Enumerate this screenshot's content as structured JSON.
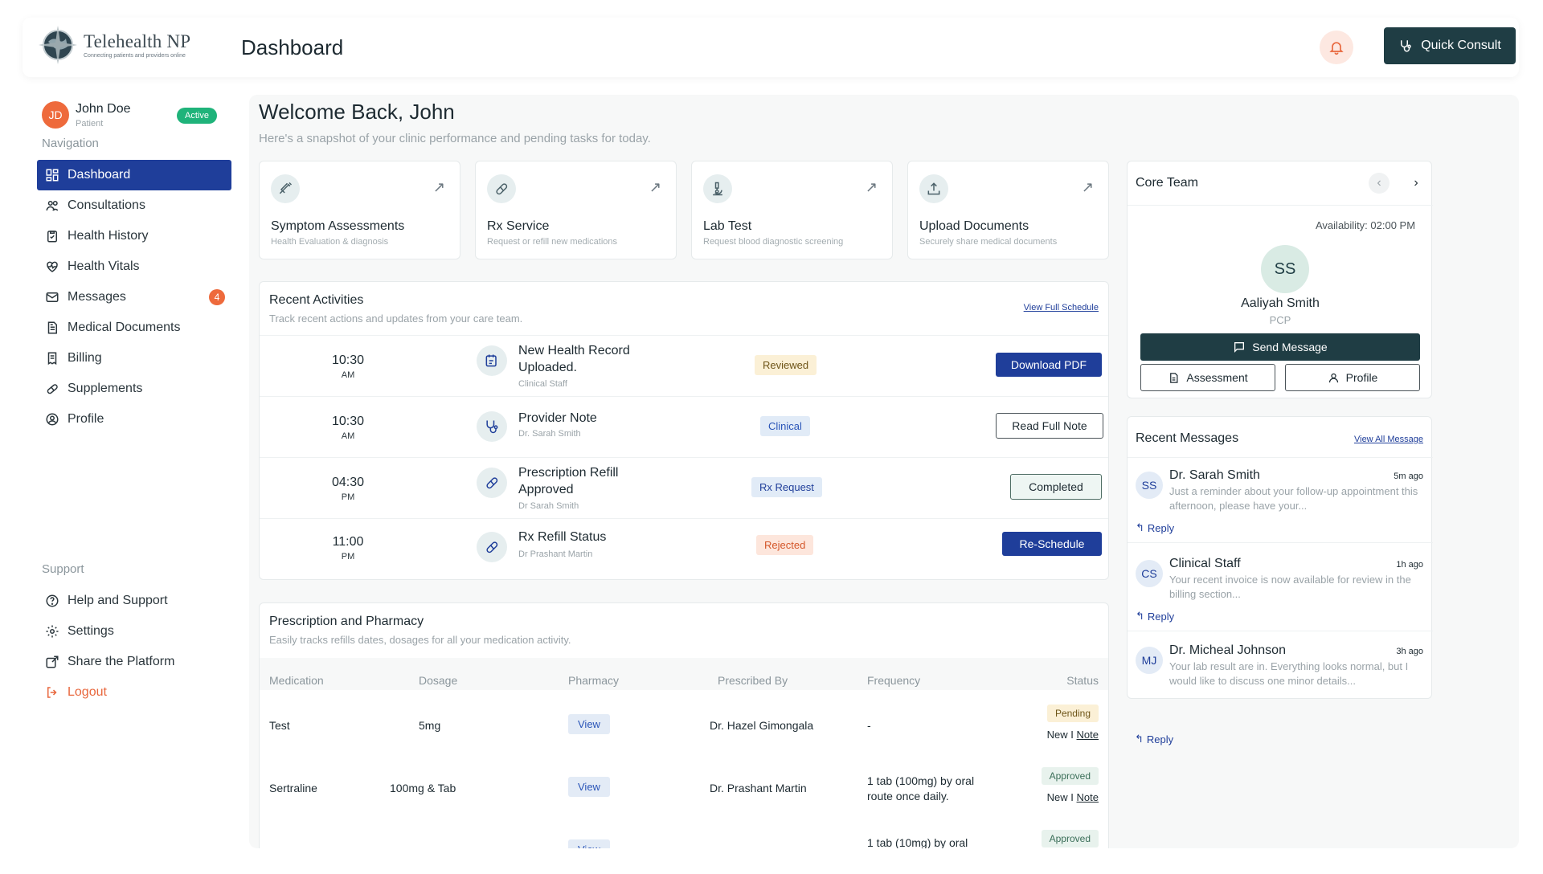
{
  "app": {
    "logo_name": "Telehealth NP",
    "logo_tagline": "Connecting patients and providers online",
    "page_title": "Dashboard",
    "quick_consult": "Quick Consult"
  },
  "user": {
    "initials": "JD",
    "name": "John Doe",
    "role": "Patient",
    "status": "Active"
  },
  "sidebar": {
    "nav_heading": "Navigation",
    "items": [
      {
        "label": "Dashboard",
        "icon": "grid-icon"
      },
      {
        "label": "Consultations",
        "icon": "users-icon"
      },
      {
        "label": "Health History",
        "icon": "clipboard-icon"
      },
      {
        "label": "Health Vitals",
        "icon": "heart-pulse-icon"
      },
      {
        "label": "Messages",
        "icon": "mail-icon",
        "count": "4"
      },
      {
        "label": "Medical Documents",
        "icon": "document-icon"
      },
      {
        "label": "Billing",
        "icon": "receipt-icon"
      },
      {
        "label": "Supplements",
        "icon": "pill-icon"
      },
      {
        "label": "Profile",
        "icon": "user-circle-icon"
      }
    ],
    "support_heading": "Support",
    "support_items": [
      {
        "label": "Help and Support",
        "icon": "help-icon"
      },
      {
        "label": "Settings",
        "icon": "gear-icon"
      },
      {
        "label": "Share the Platform",
        "icon": "share-icon"
      }
    ],
    "logout": "Logout"
  },
  "welcome": {
    "title": "Welcome Back, John",
    "subtitle": "Here's a snapshot of your clinic performance and pending tasks for today."
  },
  "services": [
    {
      "title": "Symptom Assessments",
      "subtitle": "Health Evaluation & diagnosis",
      "icon": "syringe-icon"
    },
    {
      "title": "Rx Service",
      "subtitle": "Request or refill new medications",
      "icon": "pill-icon"
    },
    {
      "title": "Lab Test",
      "subtitle": "Request blood diagnostic screening",
      "icon": "microscope-icon"
    },
    {
      "title": "Upload Documents",
      "subtitle": "Securely share medical documents",
      "icon": "upload-icon"
    }
  ],
  "activities": {
    "title": "Recent Activities",
    "subtitle": "Track recent actions and updates from your care team.",
    "link": "View Full Schedule",
    "rows": [
      {
        "time": "10:30",
        "ampm": "AM",
        "title": "New Health Record Uploaded.",
        "by": "Clinical Staff",
        "tag": "Reviewed",
        "action": "Download PDF"
      },
      {
        "time": "10:30",
        "ampm": "AM",
        "title": "Provider Note",
        "by": "Dr. Sarah Smith",
        "tag": "Clinical",
        "action": "Read Full Note"
      },
      {
        "time": "04:30",
        "ampm": "PM",
        "title": "Prescription Refill Approved",
        "by": "Dr Sarah Smith",
        "tag": "Rx Request",
        "action": "Completed"
      },
      {
        "time": "11:00",
        "ampm": "PM",
        "title": "Rx Refill Status",
        "by": "Dr Prashant Martin",
        "tag": "Rejected",
        "action": "Re-Schedule"
      }
    ]
  },
  "pharmacy": {
    "title": "Prescription and Pharmacy",
    "subtitle": "Easily tracks refills dates, dosages for all your medication activity.",
    "columns": [
      "Medication",
      "Dosage",
      "Pharmacy",
      "Prescribed By",
      "Frequency",
      "Status"
    ],
    "rows": [
      {
        "medication": "Test",
        "dosage": "5mg",
        "pharmacy": "View",
        "prescribed_by": "Dr. Hazel Gimongala",
        "frequency": "-",
        "status": "Pending",
        "new": "New",
        "note": "Note"
      },
      {
        "medication": "Sertraline",
        "dosage": "100mg & Tab",
        "pharmacy": "View",
        "prescribed_by": "Dr. Prashant Martin",
        "frequency": "1 tab (100mg) by oral route once daily.",
        "status": "Approved",
        "new": "New",
        "note": "Note"
      },
      {
        "medication": "",
        "dosage": "",
        "pharmacy": "View",
        "prescribed_by": "",
        "frequency": "1 tab (10mg) by oral",
        "status": "Approved"
      }
    ]
  },
  "core_team": {
    "title": "Core Team",
    "availability": "Availability: 02:00 PM",
    "initials": "SS",
    "name": "Aaliyah Smith",
    "role": "PCP",
    "send_message": "Send Message",
    "assessment": "Assessment",
    "profile": "Profile"
  },
  "messages": {
    "title": "Recent Messages",
    "link": "View All Message",
    "reply": "Reply",
    "items": [
      {
        "initials": "SS",
        "name": "Dr. Sarah Smith",
        "time": "5m ago",
        "body": "Just a reminder about your follow-up appointment this afternoon, please have your..."
      },
      {
        "initials": "CS",
        "name": "Clinical Staff",
        "time": "1h ago",
        "body": "Your recent invoice is now available for review in the billing section..."
      },
      {
        "initials": "MJ",
        "name": "Dr. Micheal Johnson",
        "time": "3h ago",
        "body": "Your lab result are in. Everything looks normal, but I would like to discuss one minor details..."
      }
    ]
  }
}
